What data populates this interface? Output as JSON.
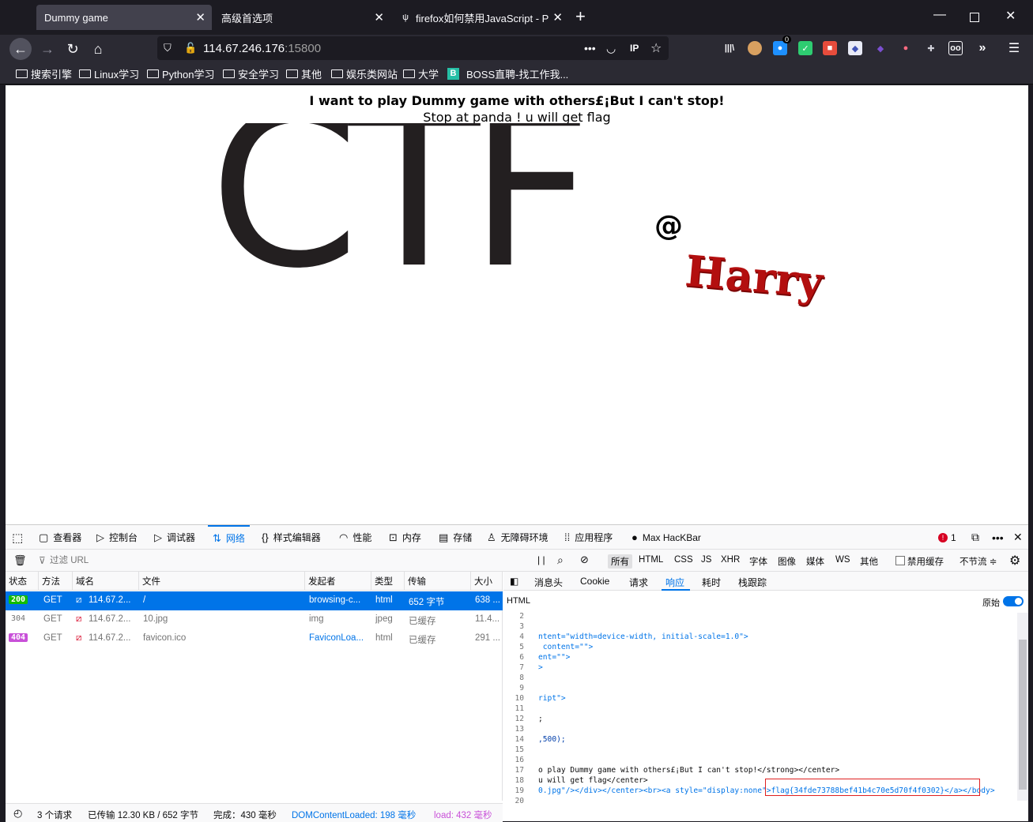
{
  "browser": {
    "tabs": [
      {
        "title": "Dummy game",
        "active": true
      },
      {
        "title": "高级首选项",
        "active": false
      },
      {
        "title": "firefox如何禁用JavaScript - P",
        "active": false
      }
    ],
    "url": {
      "host": "114.67.246.176",
      "port": ":15800"
    },
    "bookmarks": [
      "搜索引擎",
      "Linux学习",
      "Python学习",
      "安全学习",
      "其他",
      "娱乐类网站",
      "大学",
      "BOSS直聘-找工作我..."
    ],
    "extensions": {
      "badge_count": "0",
      "ip_label": "IP"
    }
  },
  "page": {
    "headline": "I want to play Dummy game with others£¡But I can't stop!",
    "subline": "Stop at panda ! u will get flag",
    "logo_text": "CTF",
    "at_sign": "@",
    "signature": "Harry"
  },
  "devtools": {
    "tabs": [
      "查看器",
      "控制台",
      "调试器",
      "网络",
      "样式编辑器",
      "性能",
      "内存",
      "存储",
      "无障碍环境",
      "应用程序",
      "Max HacKBar"
    ],
    "selected_tab": "网络",
    "error_count": "1",
    "filter_placeholder": "过滤 URL",
    "filter_types": [
      "所有",
      "HTML",
      "CSS",
      "JS",
      "XHR",
      "字体",
      "图像",
      "媒体",
      "WS",
      "其他"
    ],
    "disable_cache": "禁用缓存",
    "throttle": "不节流 ≑",
    "columns": [
      "状态",
      "方法",
      "域名",
      "文件",
      "发起者",
      "类型",
      "传输",
      "大小"
    ],
    "requests": [
      {
        "status": "200",
        "method": "GET",
        "domain": "114.67.2...",
        "file": "/",
        "initiator": "browsing-c...",
        "type": "html",
        "transfer": "652 字节",
        "size": "638 ..."
      },
      {
        "status": "304",
        "method": "GET",
        "domain": "114.67.2...",
        "file": "10.jpg",
        "initiator": "img",
        "type": "jpeg",
        "transfer": "已缓存",
        "size": "11.4..."
      },
      {
        "status": "404",
        "method": "GET",
        "domain": "114.67.2...",
        "file": "favicon.ico",
        "initiator": "FaviconLoa...",
        "type": "html",
        "transfer": "已缓存",
        "size": "291 ..."
      }
    ],
    "detail_tabs": [
      "消息头",
      "Cookie",
      "请求",
      "响应",
      "耗时",
      "栈跟踪"
    ],
    "detail_selected": "响应",
    "html_label": "HTML",
    "raw_label": "原始",
    "status_bar": {
      "requests": "3 个请求",
      "transferred": "已传输 12.30 KB / 652 字节",
      "finish": "完成：430 毫秒",
      "dcl": "DOMContentLoaded: 198 毫秒",
      "load": "load: 432 毫秒"
    },
    "code_lines": [
      {
        "n": "2",
        "text": ""
      },
      {
        "n": "3",
        "text": ""
      },
      {
        "n": "4",
        "text": "ntent=\"width=device-width, initial-scale=1.0\">"
      },
      {
        "n": "5",
        "text": " content=\"\">"
      },
      {
        "n": "6",
        "text": "ent=\"\">"
      },
      {
        "n": "7",
        "text": ">"
      },
      {
        "n": "8",
        "text": ""
      },
      {
        "n": "9",
        "text": ""
      },
      {
        "n": "10",
        "text": "ript\">"
      },
      {
        "n": "11",
        "text": ""
      },
      {
        "n": "12",
        "text": ";"
      },
      {
        "n": "13",
        "text": ""
      },
      {
        "n": "14",
        "text": ",500);"
      },
      {
        "n": "15",
        "text": ""
      },
      {
        "n": "16",
        "text": ""
      },
      {
        "n": "17",
        "text": "o play Dummy game with others£¡But I can't stop!</strong></center>"
      },
      {
        "n": "18",
        "text": "u will get flag</center>"
      },
      {
        "n": "19",
        "text": "0.jpg\"/></div></center><br><a style=\"display:none\">flag{34fde73788bef41b4c70e5d70f4f0302}</a></body>"
      },
      {
        "n": "20",
        "text": ""
      }
    ],
    "flag": "flag{34fde73788bef41b4c70e5d70f4f0302}"
  }
}
